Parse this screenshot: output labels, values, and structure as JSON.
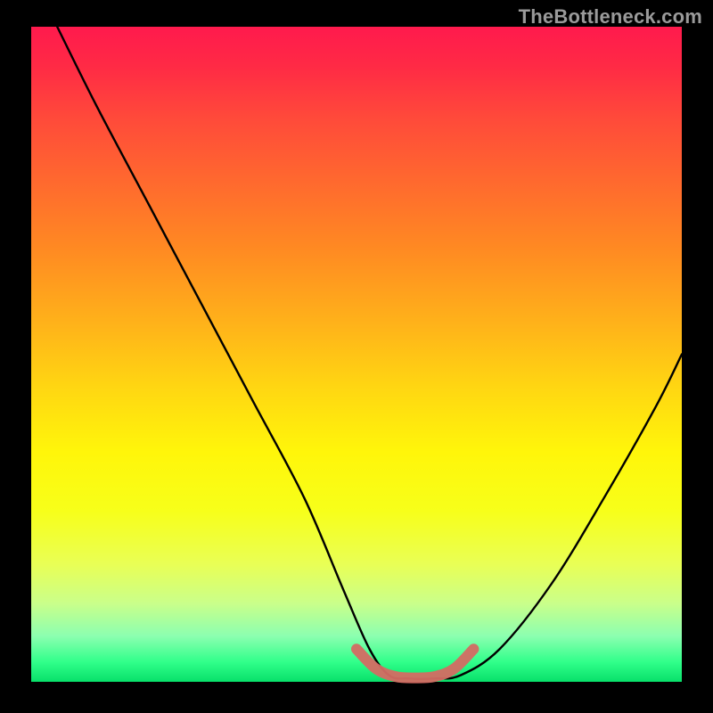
{
  "watermark": "TheBottleneck.com",
  "chart_data": {
    "type": "line",
    "title": "",
    "xlabel": "",
    "ylabel": "",
    "xlim": [
      0,
      100
    ],
    "ylim": [
      0,
      100
    ],
    "series": [
      {
        "name": "bottleneck-curve",
        "x": [
          4,
          10,
          18,
          26,
          34,
          42,
          48,
          52,
          55,
          58,
          62,
          66,
          72,
          80,
          88,
          96,
          100
        ],
        "y": [
          100,
          88,
          73,
          58,
          43,
          28,
          14,
          5,
          1,
          0.5,
          0.5,
          1,
          5,
          15,
          28,
          42,
          50
        ]
      }
    ],
    "highlight_segment": {
      "name": "optimal-range",
      "color": "#d46b63",
      "x": [
        50,
        53,
        56,
        59,
        62,
        65,
        68
      ],
      "y": [
        5,
        2,
        0.8,
        0.6,
        0.8,
        2,
        5
      ]
    },
    "background": "rainbow-vertical",
    "grid": false,
    "legend": false
  }
}
